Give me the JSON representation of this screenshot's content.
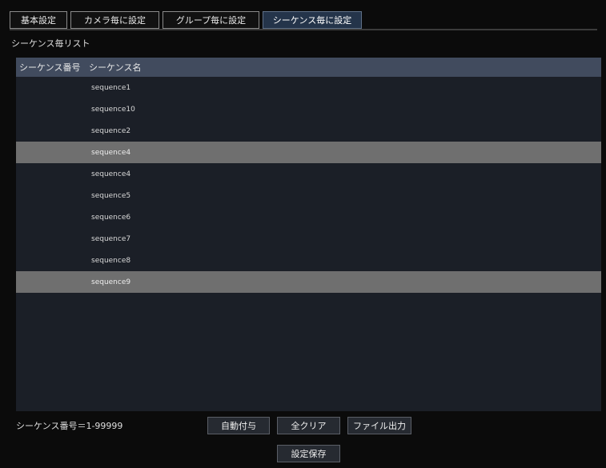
{
  "tabs": [
    "基本設定",
    "カメラ毎に設定",
    "グループ毎に設定",
    "シーケンス毎に設定"
  ],
  "active_tab_index": 3,
  "list": {
    "title": "シーケンス毎リスト",
    "columns": [
      "シーケンス番号",
      "シーケンス名"
    ],
    "rows": [
      {
        "number": "",
        "name": "sequence1"
      },
      {
        "number": "",
        "name": "sequence10"
      },
      {
        "number": "",
        "name": "sequence2"
      },
      {
        "number": "",
        "name": "sequence4",
        "selected": true
      },
      {
        "number": "",
        "name": "sequence4"
      },
      {
        "number": "",
        "name": "sequence5"
      },
      {
        "number": "",
        "name": "sequence6"
      },
      {
        "number": "",
        "name": "sequence7"
      },
      {
        "number": "",
        "name": "sequence8"
      },
      {
        "number": "",
        "name": "sequence9",
        "selected": true
      }
    ]
  },
  "footer": {
    "count_text": "シーケンス番号＝1-99999",
    "buttons": {
      "auto_number": "自動付与",
      "clear_all": "全クリア",
      "file_export": "ファイル出力",
      "save_settings": "設定保存"
    }
  },
  "colors": {
    "background": "#0b0b0b",
    "active_tab": "#24344a",
    "table_header": "#414b5e",
    "table_body": "#1b1f27",
    "selected_row": "#6f6f6f",
    "button": "#262a31"
  }
}
